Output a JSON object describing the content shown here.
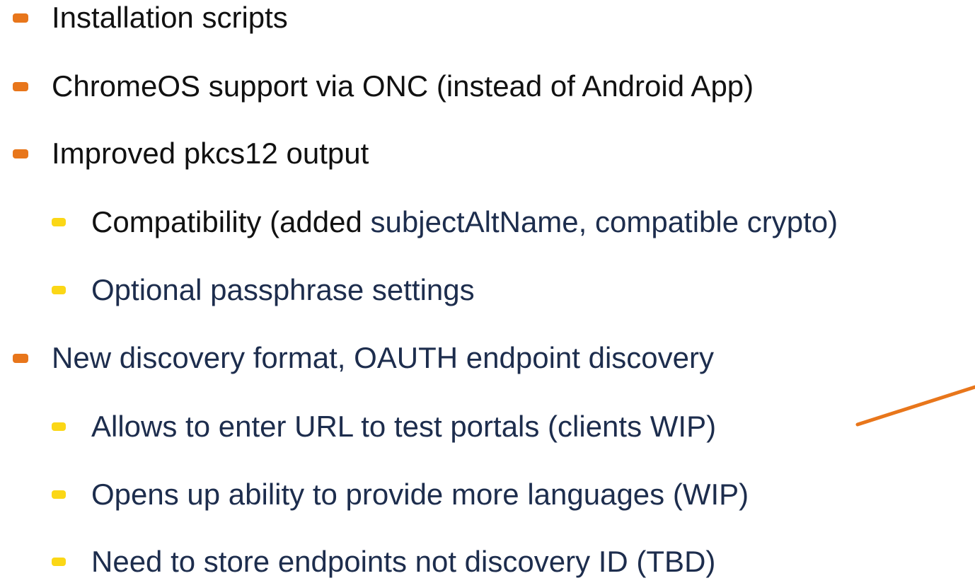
{
  "colors": {
    "l1_bullet": "#e8761b",
    "l2_bullet": "#fbd716",
    "black_text": "#111111",
    "navy_text": "#1d2d4d",
    "connector": "#e8761b"
  },
  "items": [
    {
      "level": 1,
      "parts": [
        {
          "text": "Installation scripts",
          "tone": "black"
        }
      ]
    },
    {
      "level": 1,
      "parts": [
        {
          "text": "ChromeOS support via ONC (instead of Android App)",
          "tone": "black"
        }
      ]
    },
    {
      "level": 1,
      "parts": [
        {
          "text": "Improved pkcs12 output",
          "tone": "black"
        }
      ]
    },
    {
      "level": 2,
      "parts": [
        {
          "text": "Compatibility (added ",
          "tone": "black"
        },
        {
          "text": "subjectAltName, compatible crypto)",
          "tone": "navy"
        }
      ]
    },
    {
      "level": 2,
      "parts": [
        {
          "text": "Optional passphrase settings",
          "tone": "navy"
        }
      ]
    },
    {
      "level": 1,
      "parts": [
        {
          "text": "New discovery format, OAUTH endpoint discovery",
          "tone": "navy"
        }
      ]
    },
    {
      "level": 2,
      "parts": [
        {
          "text": "Allows to enter URL to test portals (clients WIP)",
          "tone": "navy"
        }
      ]
    },
    {
      "level": 2,
      "parts": [
        {
          "text": "Opens up ability to provide more languages (WIP)",
          "tone": "navy"
        }
      ]
    },
    {
      "level": 2,
      "parts": [
        {
          "text": "Need to store endpoints not discovery ID (TBD)",
          "tone": "navy"
        }
      ]
    }
  ]
}
